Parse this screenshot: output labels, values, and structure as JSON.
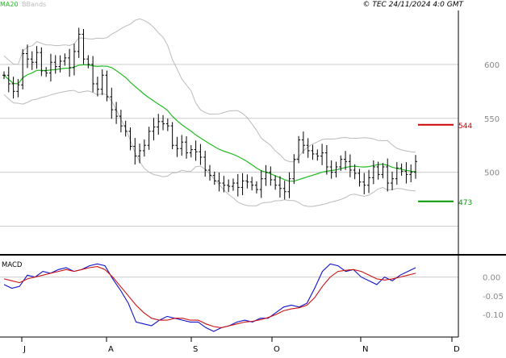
{
  "copyright": "© TEC 24/11/2024 4:0 GMT",
  "legend": {
    "ma_label": "MA20",
    "bb_label": "BBands"
  },
  "colors": {
    "bars": "#000000",
    "ma": "#22bb22",
    "bands": "#bbbbbb",
    "grid": "#cccccc",
    "resistance": "#cc0000",
    "support": "#009900",
    "macd": "#1111cc",
    "signal": "#cc1111",
    "text_gray": "#888888"
  },
  "chart_data": [
    {
      "type": "ohlc",
      "title": "",
      "x_tick_labels": [
        "J",
        "A",
        "S",
        "O",
        "N",
        "D"
      ],
      "y_tick_labels": [
        "600",
        "550",
        "500"
      ],
      "y_range": [
        425,
        650
      ],
      "levels": [
        {
          "name": "resistance",
          "label": "544",
          "value": 544
        },
        {
          "name": "support",
          "label": "473",
          "value": 473
        }
      ],
      "indicators": [
        "MA20",
        "BBands"
      ],
      "closes": [
        590,
        582,
        575,
        581,
        610,
        605,
        602,
        611,
        594,
        592,
        602,
        598,
        603,
        606,
        597,
        612,
        628,
        605,
        600,
        582,
        577,
        590,
        570,
        558,
        552,
        543,
        538,
        524,
        515,
        520,
        525,
        538,
        542,
        547,
        545,
        543,
        525,
        522,
        528,
        518,
        521,
        519,
        514,
        502,
        497,
        492,
        490,
        488,
        487,
        490,
        486,
        492,
        491,
        488,
        484,
        494,
        500,
        493,
        488,
        485,
        482,
        494,
        512,
        530,
        525,
        520,
        517,
        515,
        518,
        505,
        500,
        505,
        512,
        510,
        502,
        499,
        491,
        488,
        495,
        505,
        498,
        505,
        490,
        494,
        504,
        501,
        498,
        500,
        510
      ]
    },
    {
      "type": "line",
      "title": "MACD",
      "y_tick_labels": [
        "0.00",
        "-0.05",
        "-0.10"
      ],
      "y_range": [
        -0.16,
        0.055
      ],
      "series": [
        {
          "key": "macd",
          "values": [
            -0.02,
            -0.03,
            -0.025,
            0.005,
            0.0,
            0.015,
            0.01,
            0.02,
            0.025,
            0.015,
            0.02,
            0.03,
            0.035,
            0.03,
            -0.005,
            -0.035,
            -0.07,
            -0.12,
            -0.125,
            -0.13,
            -0.115,
            -0.105,
            -0.11,
            -0.115,
            -0.12,
            -0.12,
            -0.135,
            -0.145,
            -0.135,
            -0.13,
            -0.12,
            -0.115,
            -0.12,
            -0.11,
            -0.11,
            -0.095,
            -0.08,
            -0.075,
            -0.08,
            -0.07,
            -0.03,
            0.015,
            0.035,
            0.03,
            0.015,
            0.02,
            0.0,
            -0.01,
            -0.02,
            0.0,
            -0.01,
            0.005,
            0.015,
            0.025
          ]
        },
        {
          "key": "signal",
          "values": [
            -0.005,
            -0.01,
            -0.015,
            -0.005,
            0.0,
            0.005,
            0.01,
            0.015,
            0.02,
            0.015,
            0.02,
            0.025,
            0.028,
            0.02,
            0.0,
            -0.025,
            -0.05,
            -0.075,
            -0.095,
            -0.11,
            -0.115,
            -0.115,
            -0.11,
            -0.11,
            -0.115,
            -0.115,
            -0.125,
            -0.132,
            -0.135,
            -0.13,
            -0.125,
            -0.12,
            -0.118,
            -0.114,
            -0.108,
            -0.1,
            -0.09,
            -0.085,
            -0.082,
            -0.075,
            -0.055,
            -0.025,
            0.0,
            0.015,
            0.018,
            0.02,
            0.015,
            0.005,
            -0.005,
            -0.008,
            -0.005,
            0.0,
            0.005,
            0.01
          ]
        }
      ]
    }
  ]
}
